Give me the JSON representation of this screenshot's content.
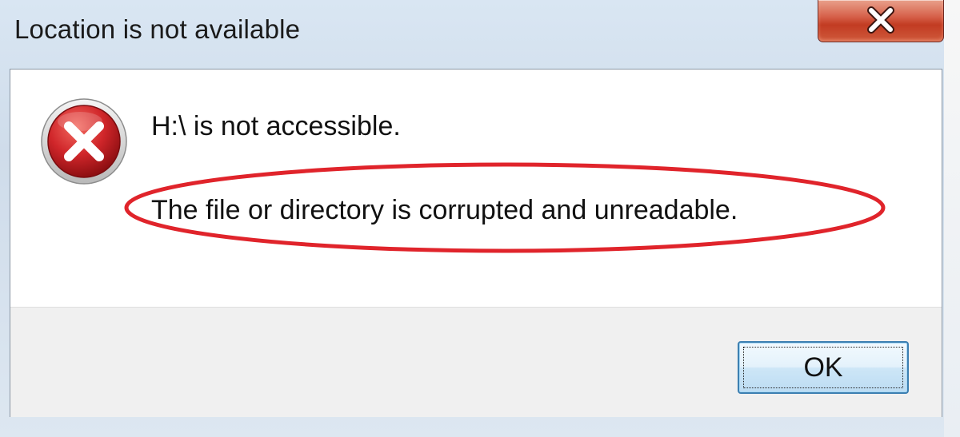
{
  "window": {
    "title": "Location is not available"
  },
  "titlebar": {
    "close_icon": "close-icon"
  },
  "message": {
    "icon": "error-icon",
    "heading": "H:\\ is not accessible.",
    "detail": "The file or directory is corrupted and unreadable."
  },
  "annotation": {
    "highlight_color": "#e0242b"
  },
  "footer": {
    "ok_label": "OK"
  },
  "colors": {
    "close_button": "#c23b22",
    "error_icon": "#c5161d",
    "ok_button_border": "#3c7fb1"
  }
}
